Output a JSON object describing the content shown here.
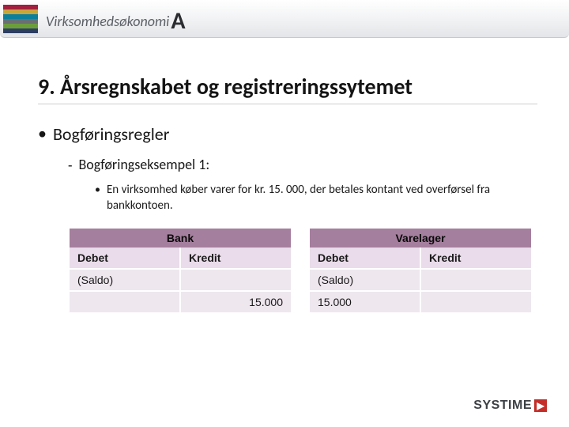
{
  "header": {
    "brand_text": "Virksomhedsøkonomi",
    "brand_suffix": "A"
  },
  "content": {
    "title": "9. Årsregnskabet og registreringssytemet",
    "bullet1": "Bogføringsregler",
    "sub1": "Bogføringseksempel 1:",
    "subsub1": "En virksomhed køber varer for kr. 15. 000, der betales kontant ved overførsel fra bankkontoen."
  },
  "tables": {
    "left": {
      "title": "Bank",
      "col1": "Debet",
      "col2": "Kredit",
      "r1c1": "(Saldo)",
      "r1c2": "",
      "r2c1": "",
      "r2c2": "15.000"
    },
    "right": {
      "title": "Varelager",
      "col1": "Debet",
      "col2": "Kredit",
      "r1c1": "(Saldo)",
      "r1c2": "",
      "r2c1": "15.000",
      "r2c2": ""
    }
  },
  "footer": {
    "brand": "SYSTIME",
    "glyph": "▶"
  }
}
